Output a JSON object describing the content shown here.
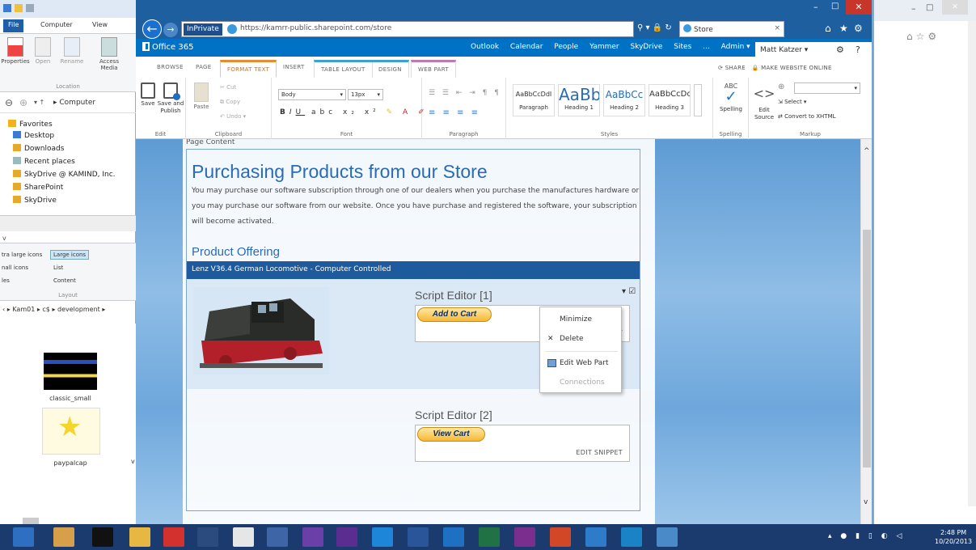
{
  "explorer": {
    "tabs": {
      "file": "File",
      "computer": "Computer",
      "view": "View"
    },
    "ribbon": {
      "properties": "Properties",
      "open": "Open",
      "rename": "Rename",
      "access_media": "Access Media",
      "group_label": "Location"
    },
    "nav_path": "Computer",
    "favorites": {
      "label": "Favorites",
      "items": [
        "Desktop",
        "Downloads",
        "Recent places",
        "SkyDrive @ KAMIND, Inc.",
        "SharePoint",
        "SkyDrive"
      ]
    },
    "view": {
      "extra_large": "tra large icons",
      "large": "Large icons",
      "small": "nall icons",
      "list": "List",
      "details": "les",
      "content": "Content",
      "group_label": "Layout"
    },
    "breadcrumb": [
      "Kam01",
      "c$",
      "development"
    ],
    "files": [
      {
        "name": "classic_small"
      },
      {
        "name": "paypalcap"
      }
    ]
  },
  "browser": {
    "inprivate": "InPrivate",
    "url": "https://kamrr-public.sharepoint.com/store",
    "url_host_bold": "sharepoint.com",
    "tab_title": "Store"
  },
  "o365": {
    "brand": "Office 365",
    "nav": [
      "Outlook",
      "Calendar",
      "People",
      "Yammer",
      "SkyDrive",
      "Sites",
      "...",
      "Admin ▾"
    ],
    "user": "Matt Katzer ▾"
  },
  "ribbon_tabs": [
    "BROWSE",
    "PAGE",
    "FORMAT TEXT",
    "INSERT",
    "TABLE LAYOUT",
    "DESIGN",
    "WEB PART"
  ],
  "share": {
    "share": "SHARE",
    "make_online": "MAKE WEBSITE ONLINE"
  },
  "ribbon": {
    "edit": {
      "save": "Save",
      "save_publish": "Save and Publish",
      "label": "Edit"
    },
    "clipboard": {
      "paste": "Paste",
      "cut": "Cut",
      "copy": "Copy",
      "undo": "Undo",
      "label": "Clipboard"
    },
    "font": {
      "family": "Body",
      "size": "13px",
      "label": "Font"
    },
    "paragraph": {
      "label": "Paragraph"
    },
    "styles": {
      "items": [
        {
          "preview": "AaBbCcDdI",
          "name": "Paragraph"
        },
        {
          "preview": "AaBb",
          "name": "Heading 1"
        },
        {
          "preview": "AaBbCc",
          "name": "Heading 2"
        },
        {
          "preview": "AaBbCcDc",
          "name": "Heading 3"
        }
      ],
      "label": "Styles"
    },
    "spelling": {
      "btn": "Spelling",
      "label": "Spelling"
    },
    "markup": {
      "edit_source": "Edit Source",
      "select": "Select",
      "convert": "Convert to XHTML",
      "label": "Markup"
    }
  },
  "page": {
    "content_label": "Page Content",
    "title": "Purchasing Products from our Store",
    "intro": "You may purchase our software subscription through one of our dealers when you purchase the manufactures hardware or you may purchase our software from our website.   Once you have purchase and registered the software, your subscription will become activated.",
    "offering_title": "Product Offering",
    "product_name": "Lenz V36.4  German Locomotive - Computer Controlled",
    "script_editor_1": "Script Editor [1]",
    "add_to_cart": "Add to Cart",
    "script_editor_2": "Script Editor [2]",
    "view_cart": "View Cart",
    "edit_snippet": "EDIT SNIPPET",
    "edit_snippet_partial": "ET"
  },
  "context_menu": {
    "minimize": "Minimize",
    "delete": "Delete",
    "edit_web_part": "Edit Web Part",
    "connections": "Connections"
  },
  "clock": {
    "time": "2:48 PM",
    "date": "10/20/2013"
  },
  "colors": {
    "o365_blue": "#0072c6",
    "title_blue": "#2a6bb5",
    "product_bar": "#1e5b9e",
    "taskbar": "#1b3b6e"
  }
}
